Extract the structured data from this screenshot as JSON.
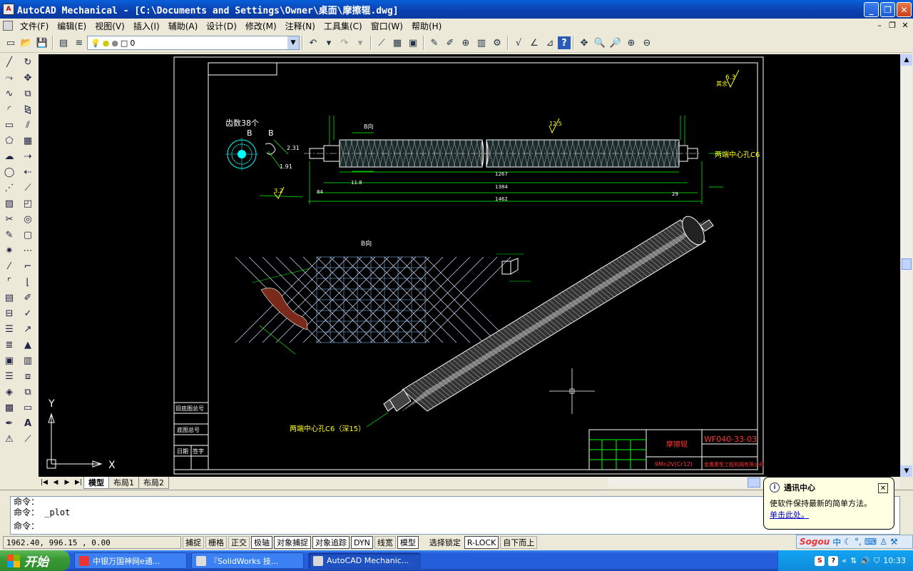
{
  "window": {
    "title": "AutoCAD Mechanical - [C:\\Documents and Settings\\Owner\\桌面\\摩擦辊.dwg]",
    "app_icon": "autocad-icon",
    "buttons": [
      "minimize",
      "restore",
      "close"
    ]
  },
  "menu": {
    "items": [
      "文件(F)",
      "编辑(E)",
      "视图(V)",
      "插入(I)",
      "辅助(A)",
      "设计(D)",
      "修改(M)",
      "注释(N)",
      "工具集(C)",
      "窗口(W)",
      "帮助(H)"
    ]
  },
  "toolbar": {
    "layer_value": "0"
  },
  "drawing": {
    "section_label_b": "B向",
    "gear_label": "齿数38个",
    "gear_letter": "B",
    "center_hole_right": "两端中心孔C6",
    "center_hole_bottom": "两端中心孔C6（深15）",
    "roughness_top": "6.3",
    "roughness_mid": "12.5",
    "roughness_left": "3.2",
    "roughness_top_label": "其余",
    "dim_1267": "1267",
    "dim_1384": "1384",
    "dim_1462": "1462",
    "dim_118": "11.8",
    "dim_84": "84",
    "dim_29": "29",
    "title_block_name": "摩擦辊",
    "title_block_material": "9Mn2V(Cr12)",
    "title_block_number": "WF040-33-03",
    "title_block_company": "金鹰重型工程机械有限公司",
    "margin_labels": [
      "旧底图总号",
      "底图总号",
      "日期",
      "签字"
    ],
    "ucs_x": "X",
    "ucs_y": "Y"
  },
  "layout_tabs": [
    "模型",
    "布局1",
    "布局2"
  ],
  "command_lines": [
    "命令：",
    "命令： _plot",
    "命令："
  ],
  "status": {
    "coords": "1962.40, 996.15 , 0.00",
    "toggles": [
      "捕捉",
      "栅格",
      "正交",
      "极轴",
      "对象捕捉",
      "对象追踪",
      "DYN",
      "线宽",
      "模型"
    ],
    "extras": [
      "选择锁定",
      "R-LOCK",
      "自下而上"
    ]
  },
  "balloon": {
    "title": "通讯中心",
    "body": "使软件保持最新的简单方法。",
    "link": "单击此处。"
  },
  "taskbar": {
    "start_label": "开始",
    "tasks": [
      "中银万国神网e通...",
      "『SolidWorks 技...",
      "AutoCAD Mechanic..."
    ],
    "time": "10:33"
  },
  "sogou": {
    "logo": "Sogou",
    "mode": "中"
  },
  "colors": {
    "drawing_bg": "#000000",
    "geometry": "#ffffff",
    "dimension": "#00ff00",
    "text": "#ffff00",
    "hatch": "#00ffff",
    "title_red": "#ff3030",
    "xp_blue": "#245edb"
  }
}
